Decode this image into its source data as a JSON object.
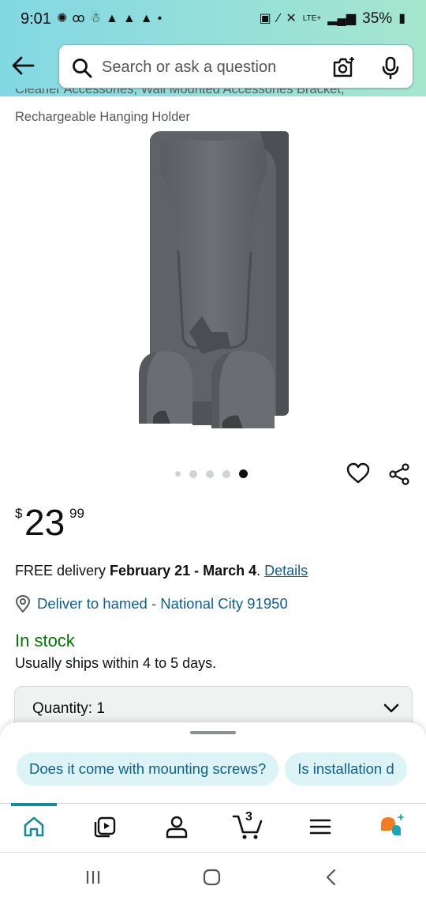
{
  "status_bar": {
    "time": "9:01",
    "battery": "35%",
    "network": "LTE+"
  },
  "header": {
    "back_icon": "arrow-left-icon",
    "search_placeholder": "Search or ask a question",
    "camera_icon": "camera-search-icon",
    "mic_icon": "microphone-icon"
  },
  "product": {
    "title_line1": "Cleaner Accessories, Wall Mounted Accessories Bracket,",
    "title_line2": "Rechargeable Hanging Holder",
    "image_dots": {
      "count": 5,
      "active_index": 4
    },
    "price_symbol": "$",
    "price_whole": "23",
    "price_fraction": "99",
    "delivery_prefix": "FREE delivery ",
    "delivery_dates": "February 21 - March 4",
    "delivery_suffix": ". ",
    "delivery_link": "Details",
    "deliver_to": "Deliver to hamed - National City 91950",
    "stock_status": "In stock",
    "ships_note": "Usually ships within 4 to 5 days.",
    "quantity_label": "Quantity:",
    "quantity_value": "1"
  },
  "questions": [
    "Does it come with mounting screws?",
    "Is installation d"
  ],
  "bottom_nav": {
    "items": [
      "home-icon",
      "video-icon",
      "account-icon",
      "cart-icon",
      "menu-icon",
      "rufus-icon"
    ],
    "cart_count": "3",
    "active": "home-icon"
  },
  "colors": {
    "header_gradient_start": "#82d8e3",
    "header_gradient_end": "#a6e6cf",
    "link": "#0f5e8f",
    "in_stock": "#007600",
    "chip_bg": "#dcf4f6",
    "nav_active": "#168a99",
    "rufus_orange": "#f47b20",
    "rufus_teal": "#1aa6b7"
  }
}
